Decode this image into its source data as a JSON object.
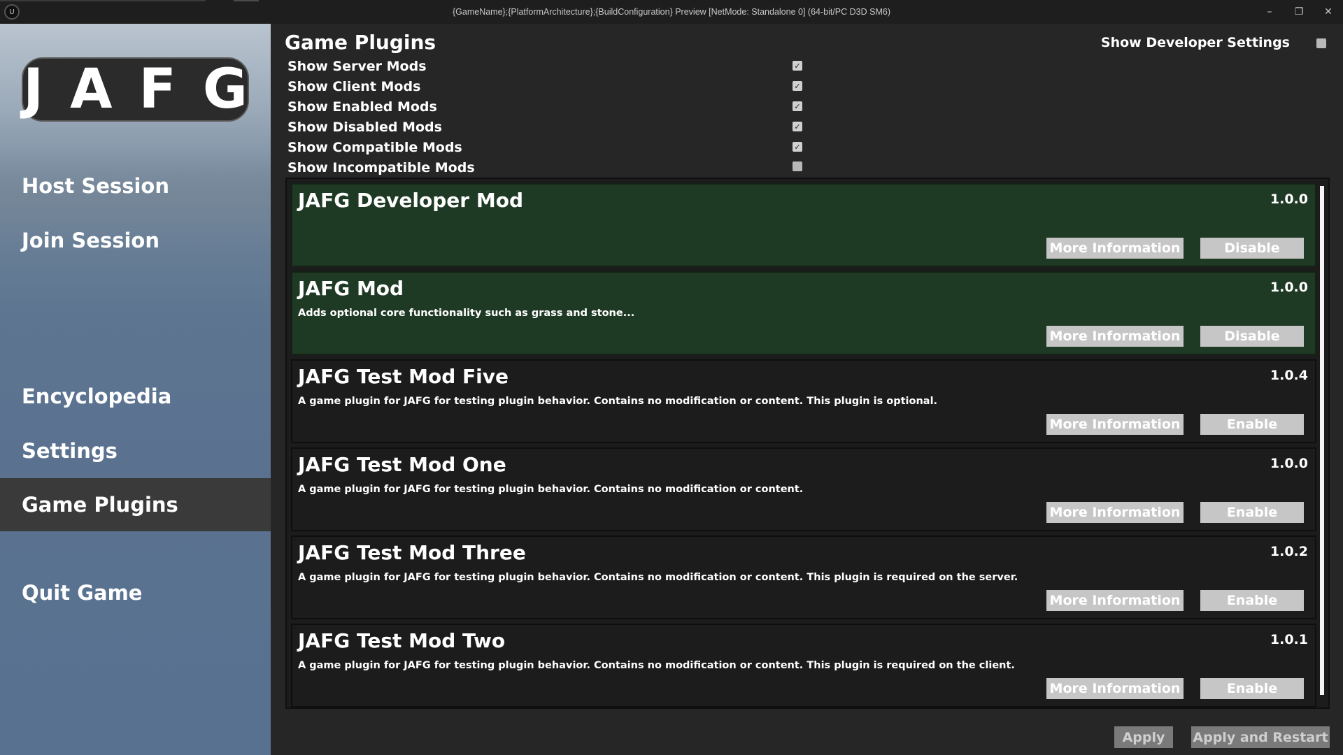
{
  "window": {
    "title": "{GameName};{PlatformArchitecture};{BuildConfiguration} Preview [NetMode: Standalone 0]  (64-bit/PC D3D SM6)",
    "app_icon": "unreal-engine-logo",
    "controls": {
      "minimize": "–",
      "restore": "❐",
      "close": "✕"
    }
  },
  "sidebar": {
    "logo_text": "JAFG",
    "items": [
      {
        "label": "Host Session",
        "active": false
      },
      {
        "label": "Join Session",
        "active": false
      },
      {
        "label": "Encyclopedia",
        "active": false
      },
      {
        "label": "Settings",
        "active": false
      },
      {
        "label": "Game Plugins",
        "active": true
      },
      {
        "label": "Quit Game",
        "active": false
      }
    ]
  },
  "main": {
    "title": "Game Plugins",
    "developer_settings": {
      "label": "Show Developer Settings",
      "checked": false
    },
    "filters": [
      {
        "label": "Show Server Mods",
        "checked": true
      },
      {
        "label": "Show Client Mods",
        "checked": true
      },
      {
        "label": "Show Enabled Mods",
        "checked": true
      },
      {
        "label": "Show Disabled Mods",
        "checked": true
      },
      {
        "label": "Show Compatible Mods",
        "checked": true
      },
      {
        "label": "Show Incompatible Mods",
        "checked": false
      }
    ],
    "mods": [
      {
        "name": "JAFG Developer Mod",
        "version": "1.0.0",
        "description": "",
        "enabled": true,
        "more_label": "More Information",
        "toggle_label": "Disable"
      },
      {
        "name": "JAFG Mod",
        "version": "1.0.0",
        "description": "Adds optional core functionality such as grass and stone...",
        "enabled": true,
        "more_label": "More Information",
        "toggle_label": "Disable"
      },
      {
        "name": "JAFG Test Mod Five",
        "version": "1.0.4",
        "description": "A game plugin for JAFG for testing plugin behavior. Contains no modification or content. This plugin is optional.",
        "enabled": false,
        "more_label": "More Information",
        "toggle_label": "Enable"
      },
      {
        "name": "JAFG Test Mod One",
        "version": "1.0.0",
        "description": "A game plugin for JAFG for testing plugin behavior. Contains no modification or content.",
        "enabled": false,
        "more_label": "More Information",
        "toggle_label": "Enable"
      },
      {
        "name": "JAFG Test Mod Three",
        "version": "1.0.2",
        "description": "A game plugin for JAFG for testing plugin behavior. Contains no modification or content. This plugin is required on the server.",
        "enabled": false,
        "more_label": "More Information",
        "toggle_label": "Enable"
      },
      {
        "name": "JAFG Test Mod Two",
        "version": "1.0.1",
        "description": "A game plugin for JAFG for testing plugin behavior. Contains no modification or content. This plugin is required on the client.",
        "enabled": false,
        "more_label": "More Information",
        "toggle_label": "Enable"
      }
    ],
    "apply_label": "Apply",
    "apply_restart_label": "Apply and Restart"
  },
  "colors": {
    "enabled_card": "#1f3a24",
    "disabled_card": "#1c1c1c",
    "button_bg": "#c6c6c6",
    "disabled_button_bg": "#7a7a7a",
    "active_nav": "#3a3a3a"
  }
}
